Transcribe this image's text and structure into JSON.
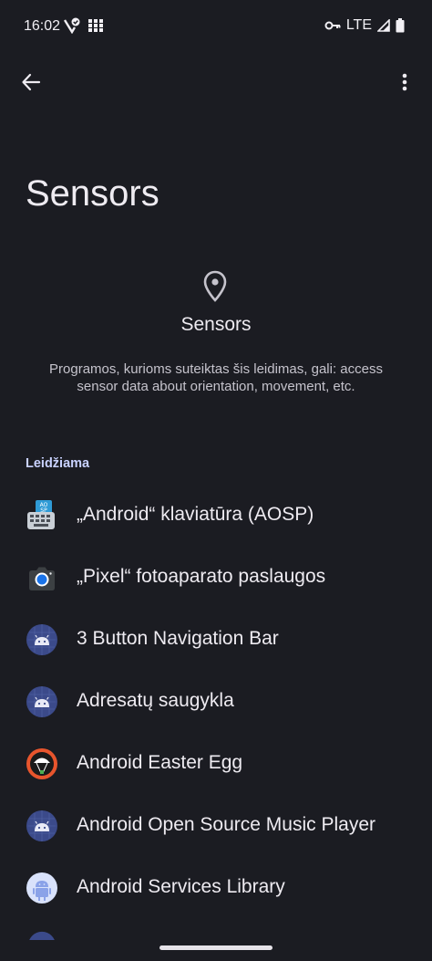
{
  "status_bar": {
    "time": "16:02",
    "network": "LTE"
  },
  "top_bar": {
    "back_icon": "arrow-back-icon",
    "more_icon": "more-vert-icon"
  },
  "page": {
    "title": "Sensors"
  },
  "permission": {
    "icon": "location-pin-icon",
    "title": "Sensors",
    "description": "Programos, kurioms suteiktas šis leidimas, gali: access sensor data about orientation, movement, etc."
  },
  "allowed_section": {
    "header": "Leidžiama",
    "apps": [
      {
        "label": "„Android“ klaviatūra (AOSP)",
        "icon": "aosp-keyboard-icon"
      },
      {
        "label": "„Pixel“ fotoaparato paslaugos",
        "icon": "camera-icon"
      },
      {
        "label": "3 Button Navigation Bar",
        "icon": "android-icon"
      },
      {
        "label": "Adresatų saugykla",
        "icon": "android-icon"
      },
      {
        "label": "Android Easter Egg",
        "icon": "easter-egg-icon"
      },
      {
        "label": "Android Open Source Music Player",
        "icon": "android-icon"
      },
      {
        "label": "Android Services Library",
        "icon": "android-services-icon"
      }
    ]
  }
}
